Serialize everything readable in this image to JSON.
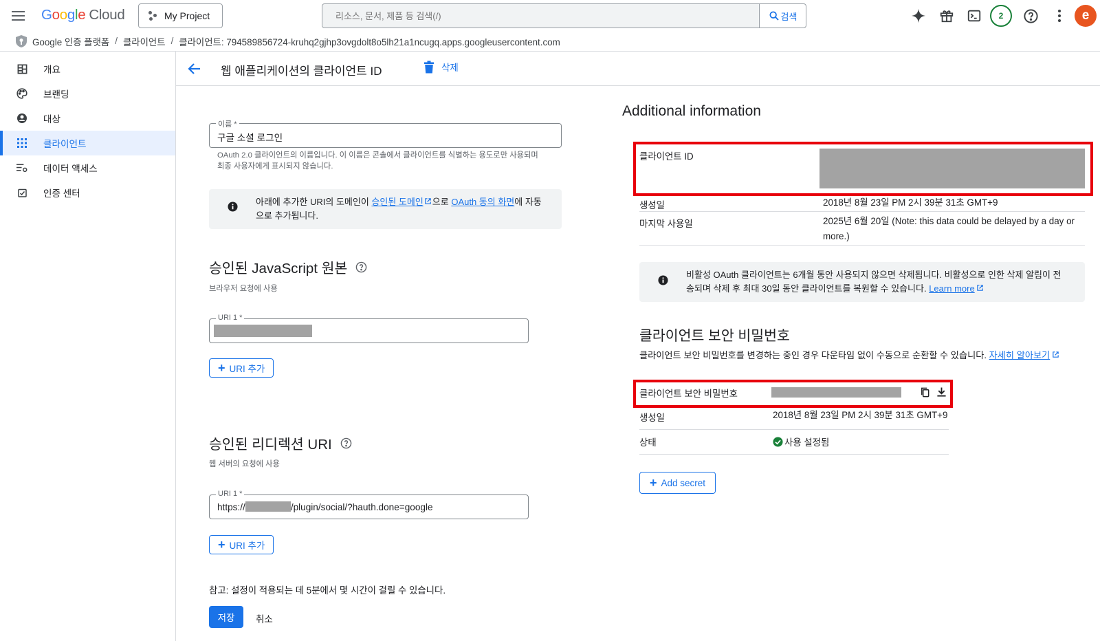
{
  "app": {
    "logo_letters": [
      "G",
      "o",
      "o",
      "g",
      "l",
      "e"
    ],
    "logo_suffix": "Cloud",
    "project": "My Project",
    "search_placeholder": "리소스, 문서, 제품 등 검색(/)",
    "search_button": "검색",
    "notifications_count": "2",
    "avatar_letter": "e"
  },
  "breadcrumb": {
    "items": [
      "Google 인증 플랫폼",
      "클라이언트",
      "클라이언트: 794589856724-kruhq2gjhp3ovgdolt8o5lh21a1ncugq.apps.googleusercontent.com"
    ],
    "separator": "/"
  },
  "sidebar": {
    "items": [
      {
        "label": "개요",
        "icon": "dashboard-icon"
      },
      {
        "label": "브랜딩",
        "icon": "palette-icon"
      },
      {
        "label": "대상",
        "icon": "account-circle-icon"
      },
      {
        "label": "클라이언트",
        "icon": "apps-grid-icon",
        "active": true
      },
      {
        "label": "데이터 액세스",
        "icon": "settings-list-icon"
      },
      {
        "label": "인증 센터",
        "icon": "verified-check-icon"
      }
    ]
  },
  "header": {
    "title": "웹 애플리케이션의 클라이언트 ID",
    "delete_label": "삭제"
  },
  "form": {
    "name_label": "이름 *",
    "name_value": "구글 소셜 로그인",
    "name_helper_1": "OAuth 2.0 클라이언트의 이름입니다. 이 이름은 콘솔에서 클라이언트를 식별하는 용도로만 사용되며",
    "name_helper_2": "최종 사용자에게 표시되지 않습니다.",
    "domain_info": {
      "text_1": "아래에 추가한 URI의 도메인이 ",
      "link_1": "승인된 도메인",
      "text_2": "으로 ",
      "link_2": "OAuth 동의 화면",
      "text_3": "에 자동",
      "text_4": "으로 추가됩니다."
    },
    "js_origins": {
      "title": "승인된 JavaScript 원본",
      "subtitle": "브라우저 요청에 사용",
      "uri_label": "URI 1 *",
      "add_label": "URI 추가"
    },
    "redirect_uris": {
      "title": "승인된 리디렉션 URI",
      "subtitle": "웹 서버의 요청에 사용",
      "uri_label": "URI 1 *",
      "uri_prefix": "https://",
      "uri_suffix": "/plugin/social/?hauth.done=google",
      "add_label": "URI 추가"
    },
    "note": "참고: 설정이 적용되는 데 5분에서 몇 시간이 걸릴 수 있습니다.",
    "save_label": "저장",
    "cancel_label": "취소"
  },
  "additional": {
    "title": "Additional information",
    "client_id_label": "클라이언트 ID",
    "created_label": "생성일",
    "created_value": "2018년 8월 23일 PM 2시 39분 31초 GMT+9",
    "last_used_label": "마지막 사용일",
    "last_used_value_1": "2025년 6월 20일 (Note: this data could be delayed by a day or",
    "last_used_value_2": "more.)",
    "inactive_info_1": "비활성 OAuth 클라이언트는 6개월 동안 사용되지 않으면 삭제됩니다. 비활성으로 인한 삭제 알림이 전",
    "inactive_info_2": "송되며 삭제 후 최대 30일 동안 클라이언트를 복원할 수 있습니다. ",
    "learn_more": "Learn more"
  },
  "secrets": {
    "title": "클라이언트 보안 비밀번호",
    "desc": "클라이언트 보안 비밀번호를 변경하는 중인 경우 다운타임 없이 수동으로 순환할 수 있습니다. ",
    "desc_link": "자세히 알아보기",
    "secret_label": "클라이언트 보안 비밀번호",
    "created_label": "생성일",
    "created_value": "2018년 8월 23일 PM 2시 39분 31초 GMT+9",
    "status_label": "상태",
    "status_value": "사용 설정됨",
    "add_secret_label": "Add secret"
  },
  "colors": {
    "accent": "#1a73e8",
    "highlight": "#e8000b",
    "status_ok": "#188038",
    "redaction": "#a3a3a3"
  }
}
